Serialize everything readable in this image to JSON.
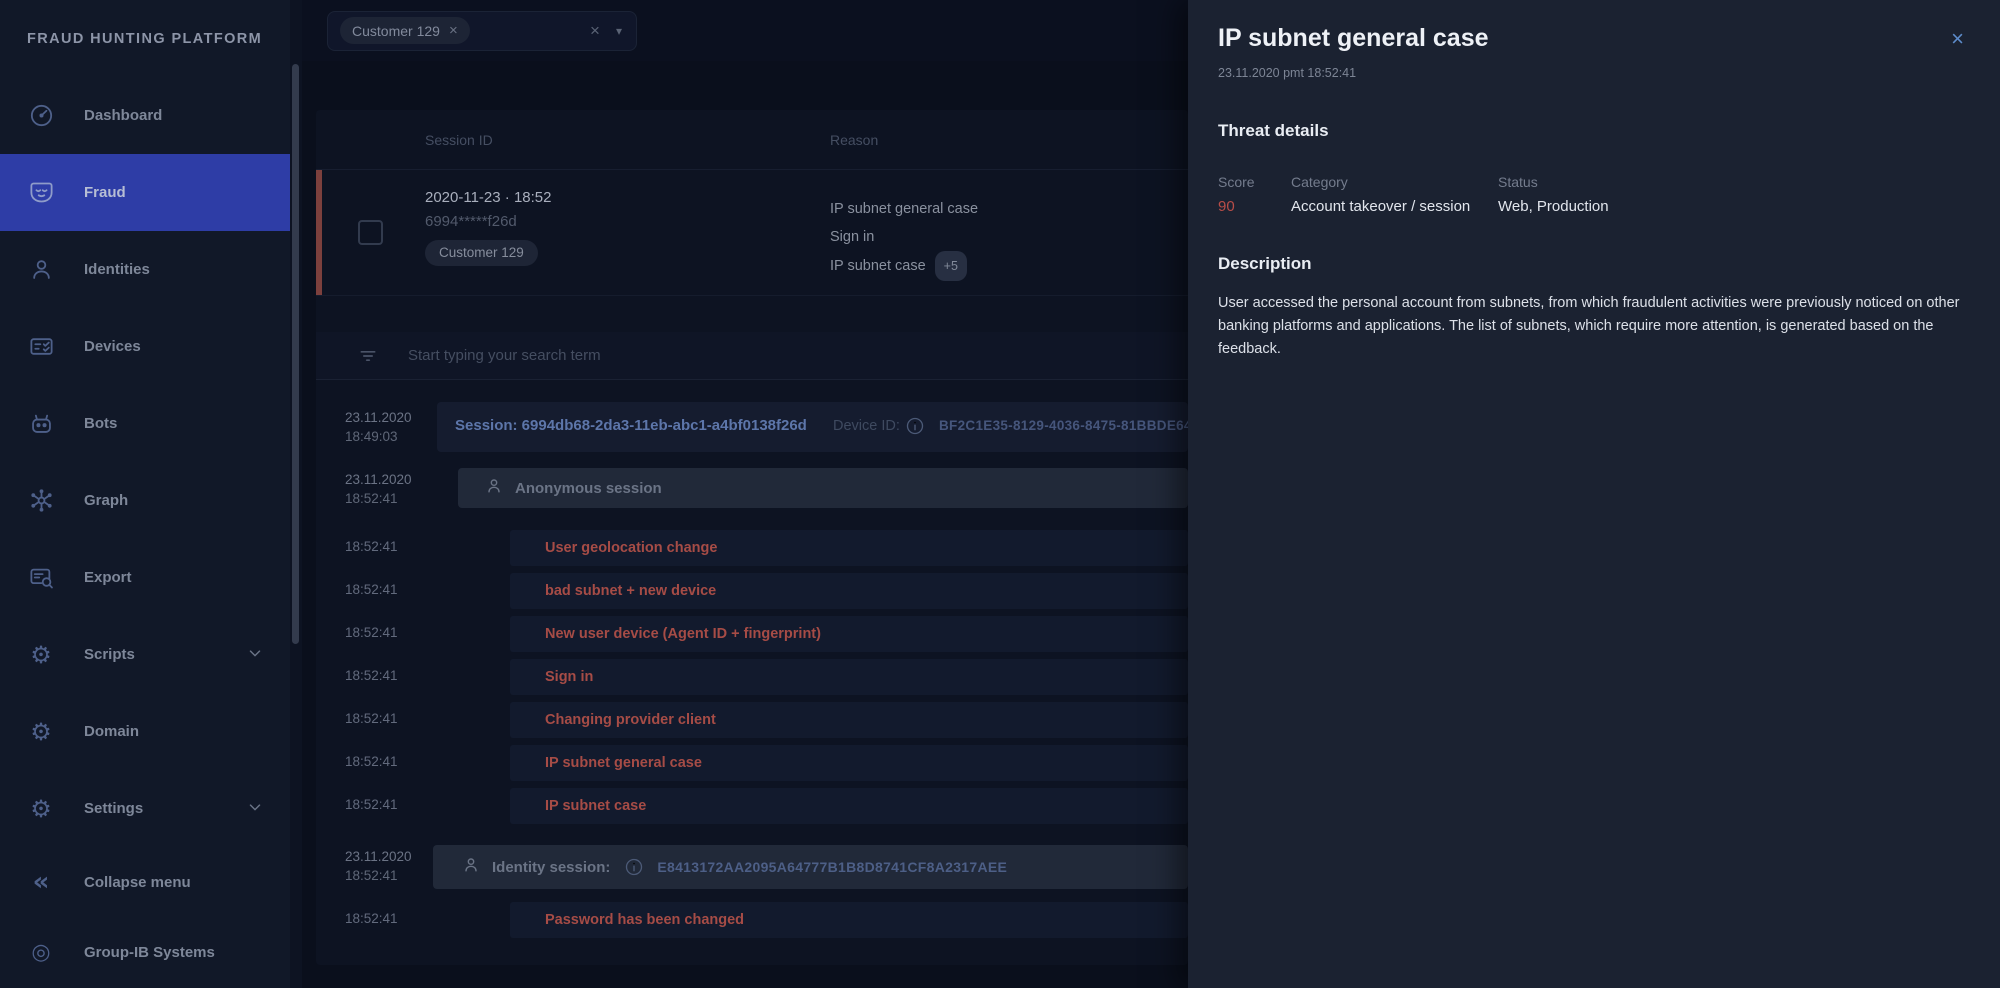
{
  "app": {
    "title": "FRAUD HUNTING PLATFORM"
  },
  "colors": {
    "accent_active": "#2e3da6",
    "alert_red": "#a64c46",
    "score_red": "#b84d48",
    "link_blue": "#5d76aa",
    "panel_bg": "#1b2231",
    "stripe_red": "#7c403d"
  },
  "icons": {
    "gear": "⚙",
    "collapse": "«",
    "target": "◎",
    "caret_down": "▾",
    "close": "×",
    "chip_remove": "×"
  },
  "sidebar": {
    "items": [
      {
        "label": "Dashboard"
      },
      {
        "label": "Fraud"
      },
      {
        "label": "Identities"
      },
      {
        "label": "Devices"
      },
      {
        "label": "Bots"
      },
      {
        "label": "Graph"
      },
      {
        "label": "Export"
      },
      {
        "label": "Scripts"
      },
      {
        "label": "Domain"
      },
      {
        "label": "Settings"
      }
    ],
    "collapse_label": "Collapse menu",
    "footer_label": "Group-IB Systems"
  },
  "filter_bar": {
    "chip": "Customer 129"
  },
  "table": {
    "columns": [
      "Session ID",
      "Reason"
    ],
    "row": {
      "datetime": "2020-11-23 · 18:52",
      "masked_id": "6994*****f26d",
      "customer_chip": "Customer 129",
      "reason_1": "IP subnet general case",
      "reason_2": "Sign in",
      "reason_3": "IP subnet case",
      "more_badge": "+5"
    }
  },
  "search": {
    "placeholder": "Start typing your search term"
  },
  "timeline": {
    "session_row": {
      "date": "23.11.2020",
      "time": "18:49:03",
      "session_label": "Session: 6994db68-2da3-11eb-abc1-a4bf0138f26d",
      "device_label": "Device ID:",
      "device_id": "BF2C1E35-8129-4036-8475-81BBDE64"
    },
    "anonymous_row": {
      "date": "23.11.2020",
      "time": "18:52:41",
      "label": "Anonymous session"
    },
    "events": [
      {
        "time": "18:52:41",
        "label": "User geolocation change"
      },
      {
        "time": "18:52:41",
        "label": "bad subnet + new device"
      },
      {
        "time": "18:52:41",
        "label": "New user device (Agent ID + fingerprint)"
      },
      {
        "time": "18:52:41",
        "label": "Sign in"
      },
      {
        "time": "18:52:41",
        "label": "Changing provider client"
      },
      {
        "time": "18:52:41",
        "label": "IP subnet general case"
      },
      {
        "time": "18:52:41",
        "label": "IP subnet case"
      }
    ],
    "identity_row": {
      "date": "23.11.2020",
      "time": "18:52:41",
      "label": "Identity session:",
      "hash": "E8413172AA2095A64777B1B8D8741CF8A2317AEE"
    },
    "last_event": {
      "time": "18:52:41",
      "label": "Password has been changed"
    }
  },
  "panel": {
    "title": "IP subnet general case",
    "subtitle": "23.11.2020 pmt 18:52:41",
    "threat": {
      "heading": "Threat details",
      "score_label": "Score",
      "score": "90",
      "category_label": "Category",
      "category": "Account takeover / session",
      "status_label": "Status",
      "status": "Web, Production"
    },
    "description": {
      "heading": "Description",
      "text": "User accessed the personal account from subnets, from which fraudulent activities were previously noticed on other banking platforms and applications. The list of subnets, which require more attention, is generated based on the feedback."
    }
  }
}
